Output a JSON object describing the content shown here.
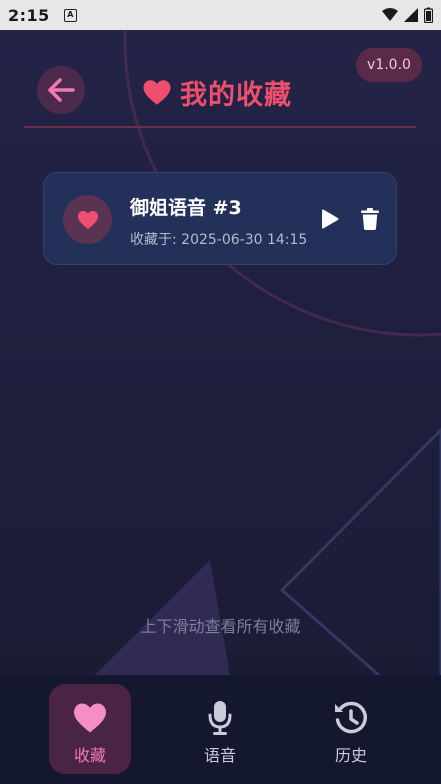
{
  "status_bar": {
    "time": "2:15",
    "app_icon_letter": "A"
  },
  "header": {
    "title": "我的收藏",
    "version": "v1.0.0"
  },
  "favorites": [
    {
      "title": "御姐语音 #3",
      "saved_at": "收藏于: 2025-06-30 14:15"
    }
  ],
  "scroll_hint": "上下滑动查看所有收藏",
  "bottom_nav": {
    "items": [
      {
        "label": "收藏",
        "icon": "heart-icon",
        "active": true
      },
      {
        "label": "语音",
        "icon": "microphone-icon",
        "active": false
      },
      {
        "label": "历史",
        "icon": "history-icon",
        "active": false
      }
    ]
  },
  "colors": {
    "accent": "#ef4f6f",
    "nav_active_bg": "#4a2443",
    "card_bg": "#23305a",
    "background": "#1c1d38"
  }
}
